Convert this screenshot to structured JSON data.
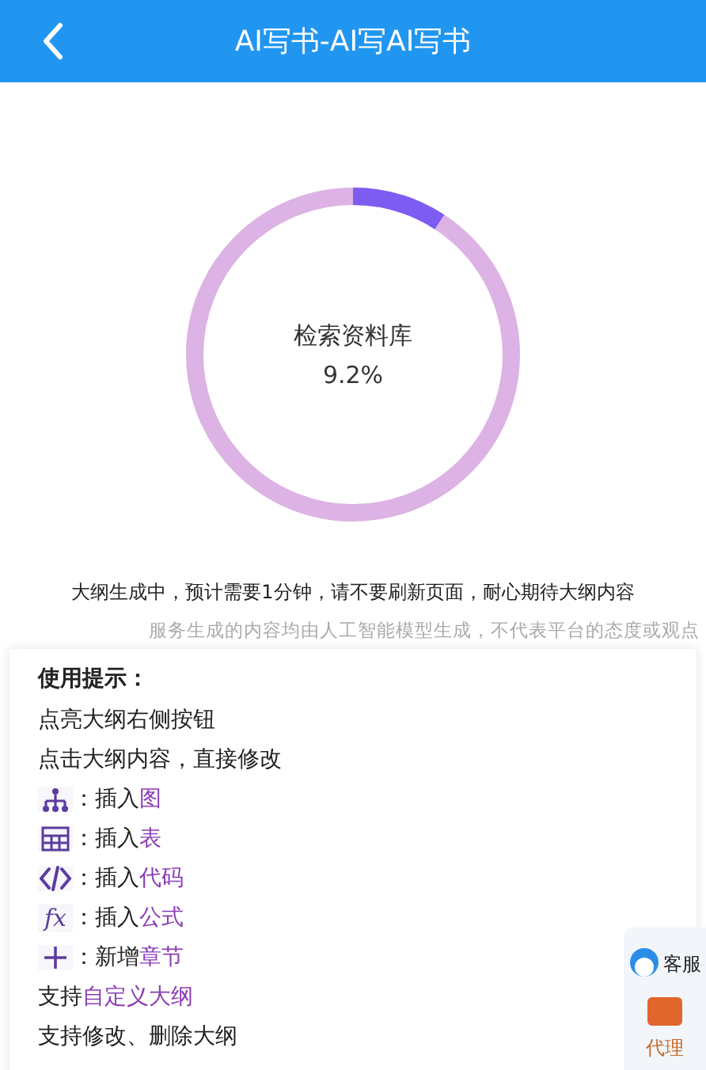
{
  "header": {
    "title": "AI写书-AI写AI写书"
  },
  "progress": {
    "label": "检索资料库",
    "reading": "9.2%"
  },
  "message": "大纲生成中，预计需要1分钟，请不要刷新页面，耐心期待大纲内容",
  "disclaimer": "服务生成的内容均由人工智能模型生成，不代表平台的态度或观点",
  "tips": {
    "title": "使用提示：",
    "items": [
      {
        "kind": "text",
        "before": "点亮大纲右侧按钮"
      },
      {
        "kind": "text",
        "before": "点击大纲内容，直接修改"
      },
      {
        "kind": "hierarchy",
        "before": "：插入",
        "link": "图"
      },
      {
        "kind": "table",
        "before": "：插入",
        "link": "表"
      },
      {
        "kind": "code",
        "before": "：插入",
        "link": "代码"
      },
      {
        "kind": "formula",
        "glyph": "fx",
        "before": "：插入",
        "link": "公式"
      },
      {
        "kind": "plus",
        "before": "：新增",
        "link": "章节"
      },
      {
        "kind": "text",
        "before": "支持",
        "link": "自定义大纲"
      },
      {
        "kind": "text",
        "before": "支持修改、删除大纲"
      }
    ]
  },
  "float_panel": {
    "service": "客服",
    "agent": "代理"
  }
}
